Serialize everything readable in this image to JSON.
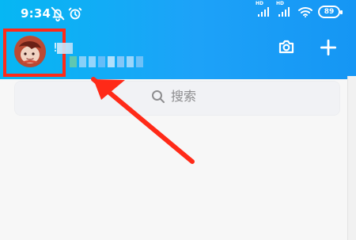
{
  "statusbar": {
    "time": "9:34",
    "battery": "89"
  },
  "header": {
    "name_text": "!"
  },
  "search": {
    "placeholder": "搜索"
  },
  "colors": {
    "header_start": "#06b7f3",
    "header_end": "#1596f4",
    "highlight": "#ff2a18",
    "background": "#f7f7f7",
    "search_bg": "#f1f2f5",
    "muted_text": "#8d8d8f"
  },
  "icons": {
    "mute": "mute-icon",
    "alarm": "alarm-icon",
    "signal": "signal-icon",
    "wifi": "wifi-icon",
    "battery": "battery-icon",
    "camera": "camera-icon",
    "plus": "plus-icon",
    "search": "search-icon",
    "arrow": "arrow-icon"
  }
}
